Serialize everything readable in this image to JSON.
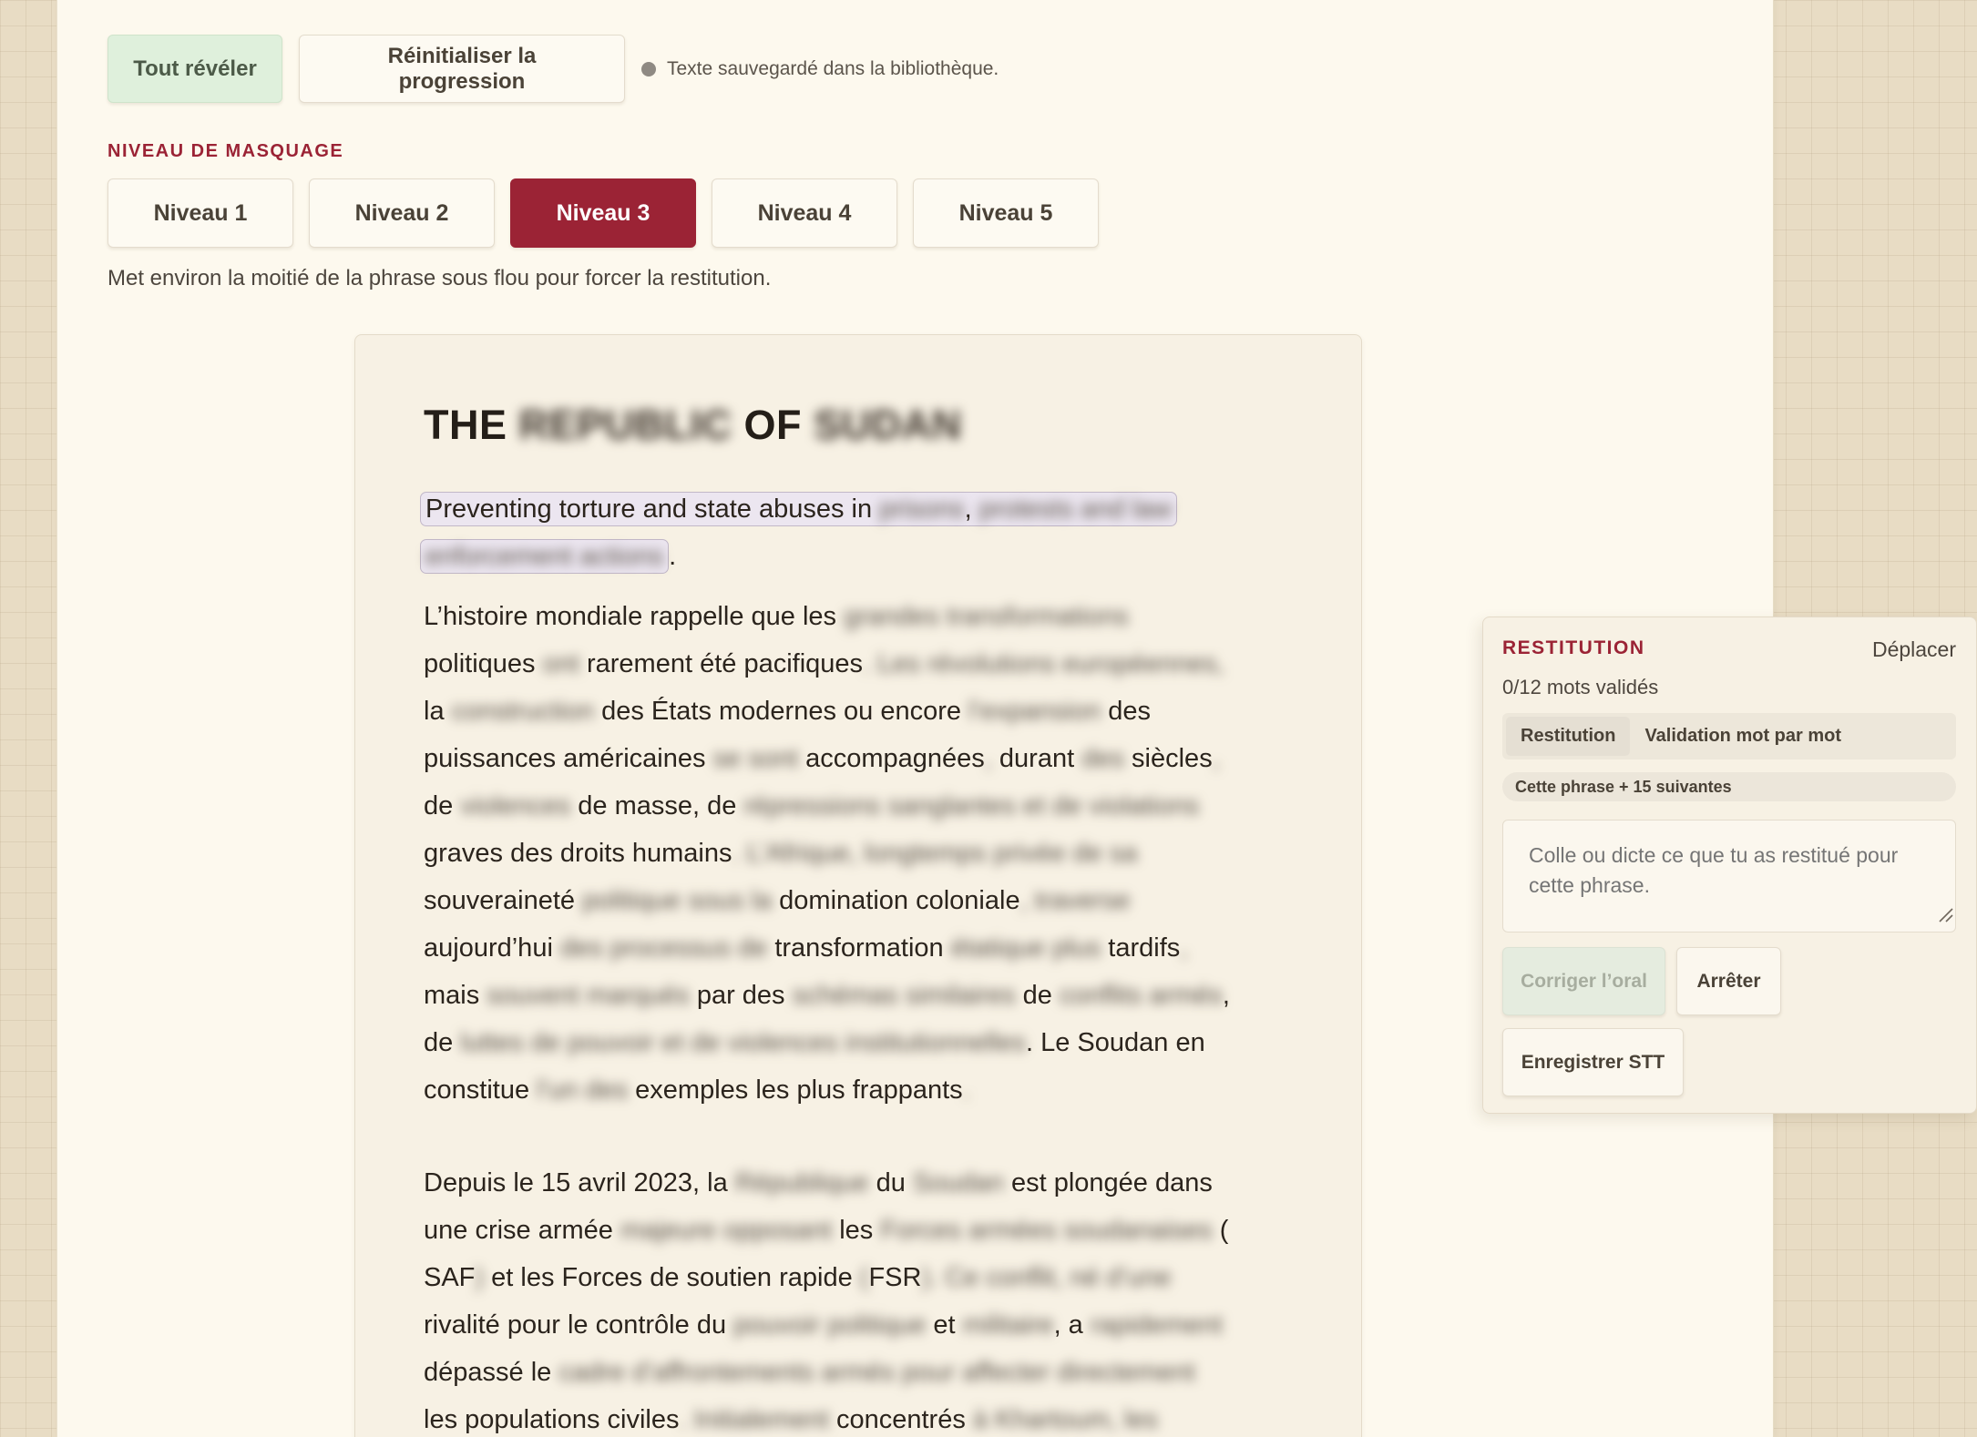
{
  "toolbar": {
    "reveal_label": "Tout révéler",
    "reset_label": "Réinitialiser la progression",
    "saved_status": "Texte sauvegardé dans la bibliothèque."
  },
  "masking": {
    "section_label": "NIVEAU DE MASQUAGE",
    "levels": [
      "Niveau 1",
      "Niveau 2",
      "Niveau 3",
      "Niveau 4",
      "Niveau 5"
    ],
    "selected": "Niveau 3",
    "description": "Met environ la moitié de la phrase sous flou pour forcer la restitution."
  },
  "document": {
    "title": [
      "THE",
      "REPUBLIC",
      "OF",
      "SUDAN"
    ],
    "subtitle": [
      "Preventing torture and state abuses in",
      "prisons",
      ",",
      "protests and law",
      "enforcement actions",
      "."
    ],
    "paragraphs": [
      [
        [
          "L’histoire mondiale rappelle que les",
          "grandes transformations"
        ],
        [
          "politiques",
          "ont",
          "rarement été pacifiques",
          ".  Les révolutions européennes,"
        ],
        [
          "la",
          "construction",
          "des États modernes ou encore",
          "l’expansion",
          "des"
        ],
        [
          "puissances américaines",
          "se sont",
          "accompagnées",
          ",",
          "durant",
          "des",
          "siècles",
          ","
        ],
        [
          "de",
          "violences",
          "de masse, de",
          "répressions sanglantes et de violations"
        ],
        [
          "graves des droits humains",
          ".  L’Afrique, longtemps privée de sa"
        ],
        [
          "souveraineté",
          "politique sous la",
          "domination coloniale",
          ", traverse"
        ],
        [
          "aujourd’hui",
          "des processus de",
          "transformation",
          "étatique plus",
          "tardifs",
          ","
        ],
        [
          "mais",
          "souvent marqués",
          "par des",
          "schémas similaires",
          "de",
          "conflits armés",
          ","
        ],
        [
          "de",
          "luttes de pouvoir et de violences institutionnelles",
          ".  Le Soudan en"
        ],
        [
          "constitue",
          "l’un des",
          "exemples les plus frappants",
          "."
        ]
      ],
      [
        [
          "Depuis le 15 avril 2023, la",
          "République",
          "du",
          "Soudan",
          "est plongée dans"
        ],
        [
          "une crise armée",
          "majeure opposant",
          "les",
          "Forces armées soudanaises",
          "("
        ],
        [
          "SAF",
          ")",
          "et les Forces de soutien rapide",
          "(",
          "FSR",
          ").  Ce conflit, né d’une"
        ],
        [
          "rivalité pour le contrôle du",
          "pouvoir politique",
          "et",
          "militaire",
          ", a",
          "rapidement"
        ],
        [
          "dépassé le",
          "cadre d’affrontements armés pour affecter directement"
        ],
        [
          "les populations civiles",
          ".  Initialement",
          "concentrés",
          "à Khartoum, les"
        ]
      ]
    ]
  },
  "restitution": {
    "title": "RESTITUTION",
    "move_label": "Déplacer",
    "count": "0/12 mots validés",
    "tabs": [
      "Restitution",
      "Validation mot par mot"
    ],
    "scope": "Cette phrase + 15 suivantes",
    "placeholder": "Colle ou dicte ce que tu as restitué pour cette phrase.",
    "correct_label": "Corriger l’oral",
    "stop_label": "Arrêter",
    "record_label": "Enregistrer STT"
  },
  "colors": {
    "accent": "#9b2335",
    "reveal_button": "#dff0dc",
    "page_background": "#fdf9ee",
    "card_background": "#f7f1e4"
  }
}
